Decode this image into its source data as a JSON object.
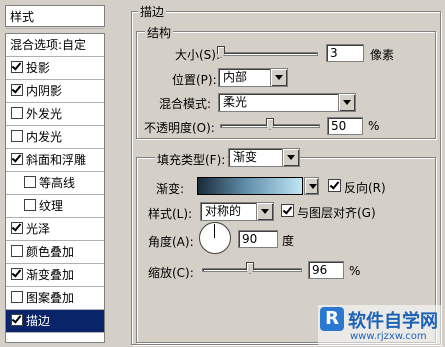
{
  "left_panel": {
    "header": "样式",
    "blend_options": "混合选项:自定",
    "items": [
      {
        "label": "投影",
        "checked": true
      },
      {
        "label": "内阴影",
        "checked": true
      },
      {
        "label": "外发光",
        "checked": false
      },
      {
        "label": "内发光",
        "checked": false
      },
      {
        "label": "斜面和浮雕",
        "checked": true
      },
      {
        "label": "等高线",
        "checked": false
      },
      {
        "label": "纹理",
        "checked": false
      },
      {
        "label": "光泽",
        "checked": true
      },
      {
        "label": "颜色叠加",
        "checked": false
      },
      {
        "label": "渐变叠加",
        "checked": true
      },
      {
        "label": "图案叠加",
        "checked": false
      },
      {
        "label": "描边",
        "checked": true
      }
    ]
  },
  "stroke": {
    "title": "描边",
    "structure": {
      "title": "结构",
      "size_label": "大小(S):",
      "size_value": "3",
      "size_unit": "像素",
      "size_slider": 0.03,
      "position_label": "位置(P):",
      "position_value": "内部",
      "blend_label": "混合模式:",
      "blend_value": "柔光",
      "opacity_label": "不透明度(O):",
      "opacity_value": "50",
      "opacity_unit": "%",
      "opacity_slider": 0.5
    },
    "fill": {
      "type_label": "填充类型(F):",
      "type_value": "渐变",
      "gradient_label": "渐变:",
      "reverse_label": "反向(R)",
      "reverse_checked": true,
      "style_label": "样式(L):",
      "style_value": "对称的",
      "align_label": "与图层对齐(G)",
      "align_checked": true,
      "angle_label": "角度(A):",
      "angle_value": "90",
      "angle_unit": "度",
      "scale_label": "缩放(C):",
      "scale_value": "96",
      "scale_unit": "%",
      "scale_slider": 0.48
    }
  },
  "watermark": {
    "logo_char": "R",
    "title": "软件自学网",
    "url": "www.rjzxw.com"
  },
  "colors": {
    "selected_bg": "#0a246a",
    "dialog_bg": "#d4d0c8"
  }
}
